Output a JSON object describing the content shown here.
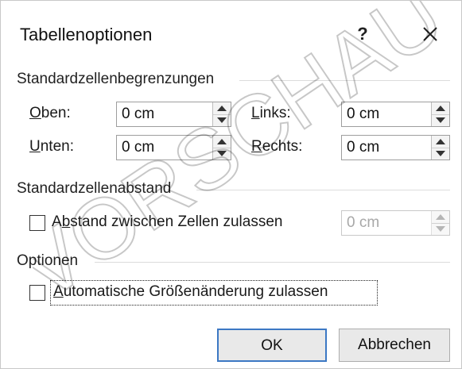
{
  "dialog": {
    "title": "Tabellenoptionen",
    "help_label": "?",
    "close_icon": "close-icon"
  },
  "cell_margins": {
    "heading": "Standardzellenbegrenzungen",
    "top": {
      "mnemonic": "O",
      "rest": "ben:",
      "value": "0 cm"
    },
    "bottom": {
      "mnemonic": "U",
      "rest": "nten:",
      "value": "0 cm"
    },
    "left": {
      "mnemonic": "L",
      "rest": "inks:",
      "value": "0 cm"
    },
    "right": {
      "mnemonic": "R",
      "rest": "echts:",
      "value": "0 cm"
    }
  },
  "cell_spacing": {
    "heading": "Standardzellenabstand",
    "allow_pre": "A",
    "allow_mnemonic": "b",
    "allow_rest": "stand zwischen Zellen zulassen",
    "allow_checked": false,
    "value": "0 cm",
    "value_disabled": true
  },
  "options": {
    "heading": "Optionen",
    "autofit_mnemonic": "A",
    "autofit_rest": "utomatische Größenänderung zulassen",
    "autofit_checked": false
  },
  "buttons": {
    "ok": "OK",
    "cancel": "Abbrechen"
  },
  "watermark": {
    "text": "VORSCHAU",
    "color": "#000000"
  }
}
